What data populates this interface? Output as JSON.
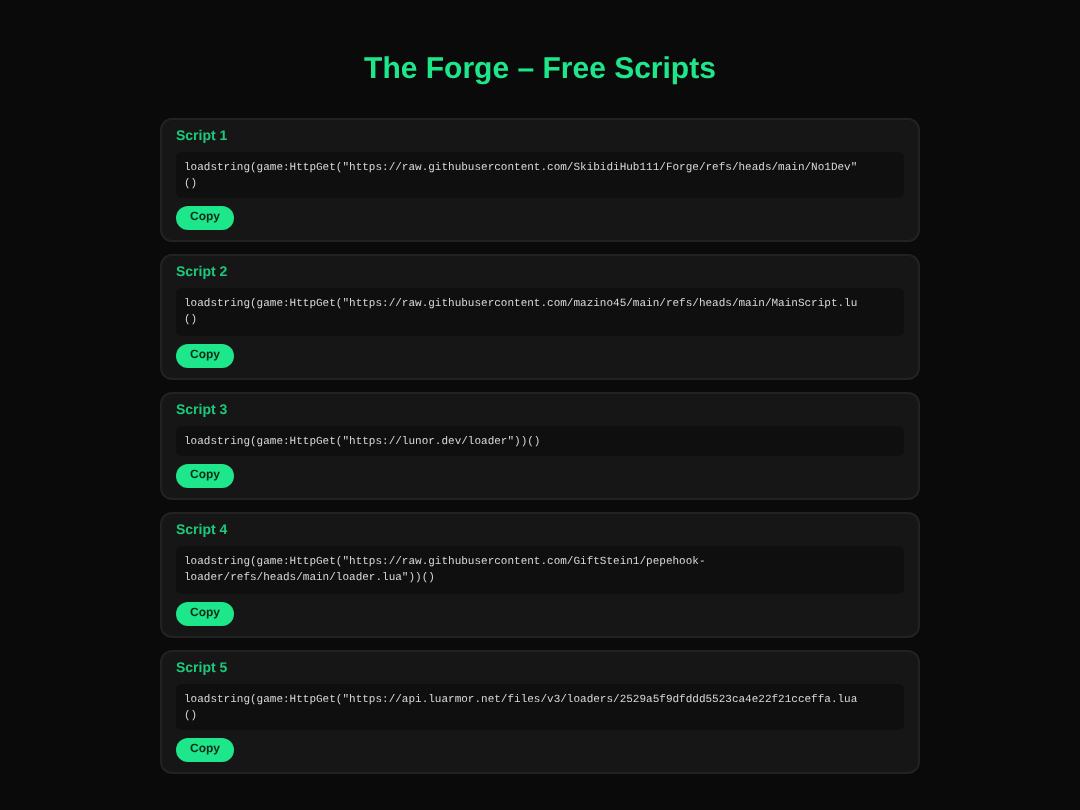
{
  "title": "The Forge – Free Scripts",
  "scripts": [
    {
      "name": "Script 1",
      "code_lines": [
        "loadstring(game:HttpGet(\"https://raw.githubusercontent.com/SkibidiHub111/Forge/refs/heads/main/No1Dev\"",
        "()"
      ],
      "button": "Copy"
    },
    {
      "name": "Script 2",
      "code_lines": [
        "loadstring(game:HttpGet(\"https://raw.githubusercontent.com/mazino45/main/refs/heads/main/MainScript.lu",
        "()"
      ],
      "button": "Copy"
    },
    {
      "name": "Script 3",
      "code_lines": [
        "loadstring(game:HttpGet(\"https://lunor.dev/loader\"))()"
      ],
      "button": "Copy"
    },
    {
      "name": "Script 4",
      "code_lines": [
        "loadstring(game:HttpGet(\"https://raw.githubusercontent.com/GiftStein1/pepehook-",
        "loader/refs/heads/main/loader.lua\"))()"
      ],
      "button": "Copy"
    },
    {
      "name": "Script 5",
      "code_lines": [
        "loadstring(game:HttpGet(\"https://api.luarmor.net/files/v3/loaders/2529a5f9dfddd5523ca4e22f21cceffa.lua",
        "()"
      ],
      "button": "Copy"
    }
  ]
}
